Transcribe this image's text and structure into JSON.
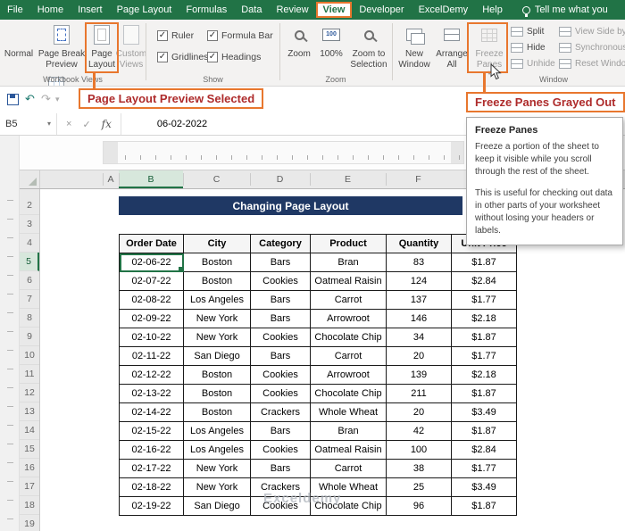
{
  "titlebar": {
    "tabs": [
      {
        "label": "File",
        "active": false
      },
      {
        "label": "Home",
        "active": false
      },
      {
        "label": "Insert",
        "active": false
      },
      {
        "label": "Page Layout",
        "active": false
      },
      {
        "label": "Formulas",
        "active": false
      },
      {
        "label": "Data",
        "active": false
      },
      {
        "label": "Review",
        "active": false
      },
      {
        "label": "View",
        "active": true
      },
      {
        "label": "Developer",
        "active": false
      },
      {
        "label": "ExcelDemy",
        "active": false
      },
      {
        "label": "Help",
        "active": false
      }
    ],
    "tell_me": "Tell me what you"
  },
  "icons": {
    "dropdown": "▾",
    "undo": "↶",
    "redo": "↷",
    "check": "✓",
    "close": "×"
  },
  "ribbon": {
    "workbook_views": {
      "caption": "Workbook Views",
      "normal": "Normal",
      "page_break_preview": "Page Break Preview",
      "page_layout": "Page Layout",
      "custom_views": "Custom Views"
    },
    "show": {
      "caption": "Show",
      "checkboxes": [
        {
          "label": "Ruler",
          "checked": true
        },
        {
          "label": "Formula Bar",
          "checked": true
        },
        {
          "label": "Gridlines",
          "checked": true
        },
        {
          "label": "Headings",
          "checked": true
        }
      ]
    },
    "zoom": {
      "caption": "Zoom",
      "zoom": "Zoom",
      "hundred": "100%",
      "zoom_to_selection": "Zoom to Selection"
    },
    "window": {
      "caption": "Window",
      "new_window": "New Window",
      "arrange_all": "Arrange All",
      "freeze_panes": "Freeze Panes",
      "split": "Split",
      "hide": "Hide",
      "unhide": "Unhide",
      "view_side_by_side": "View Side by Side",
      "synchronous_scrolling": "Synchronous Scrolling",
      "reset_window_position": "Reset Window Position"
    }
  },
  "annotations": {
    "page_layout_selected": "Page Layout Preview Selected",
    "freeze_panes_grayed": "Freeze Panes Grayed Out"
  },
  "tooltip": {
    "title": "Freeze Panes",
    "para1": "Freeze a portion of the sheet to keep it visible while you scroll through the rest of the sheet.",
    "para2": "This is useful for checking out data in other parts of your worksheet without losing your headers or labels."
  },
  "formula_bar": {
    "name_box": "B5",
    "fx": "fx",
    "value": "06-02-2022"
  },
  "sheet": {
    "column_headers": [
      "A",
      "B",
      "C",
      "D",
      "E",
      "F"
    ],
    "selected_column": "B",
    "row_numbers": [
      2,
      3,
      4,
      5,
      6,
      7,
      8,
      9,
      10,
      11,
      12,
      13,
      14,
      15,
      16,
      17,
      18,
      19
    ],
    "selected_row": 5,
    "title": "Changing Page Layout",
    "watermark": "Exceldemy",
    "table": {
      "headers": [
        "Order Date",
        "City",
        "Category",
        "Product",
        "Quantity",
        "Unit Price"
      ],
      "rows": [
        [
          "02-06-22",
          "Boston",
          "Bars",
          "Bran",
          "83",
          "$1.87"
        ],
        [
          "02-07-22",
          "Boston",
          "Cookies",
          "Oatmeal Raisin",
          "124",
          "$2.84"
        ],
        [
          "02-08-22",
          "Los Angeles",
          "Bars",
          "Carrot",
          "137",
          "$1.77"
        ],
        [
          "02-09-22",
          "New York",
          "Bars",
          "Arrowroot",
          "146",
          "$2.18"
        ],
        [
          "02-10-22",
          "New York",
          "Cookies",
          "Chocolate Chip",
          "34",
          "$1.87"
        ],
        [
          "02-11-22",
          "San Diego",
          "Bars",
          "Carrot",
          "20",
          "$1.77"
        ],
        [
          "02-12-22",
          "Boston",
          "Cookies",
          "Arrowroot",
          "139",
          "$2.18"
        ],
        [
          "02-13-22",
          "Boston",
          "Cookies",
          "Chocolate Chip",
          "211",
          "$1.87"
        ],
        [
          "02-14-22",
          "Boston",
          "Crackers",
          "Whole Wheat",
          "20",
          "$3.49"
        ],
        [
          "02-15-22",
          "Los Angeles",
          "Bars",
          "Bran",
          "42",
          "$1.87"
        ],
        [
          "02-16-22",
          "Los Angeles",
          "Cookies",
          "Oatmeal Raisin",
          "100",
          "$2.84"
        ],
        [
          "02-17-22",
          "New York",
          "Bars",
          "Carrot",
          "38",
          "$1.77"
        ],
        [
          "02-18-22",
          "New York",
          "Crackers",
          "Whole Wheat",
          "25",
          "$3.49"
        ],
        [
          "02-19-22",
          "San Diego",
          "Cookies",
          "Chocolate Chip",
          "96",
          "$1.87"
        ]
      ]
    }
  }
}
